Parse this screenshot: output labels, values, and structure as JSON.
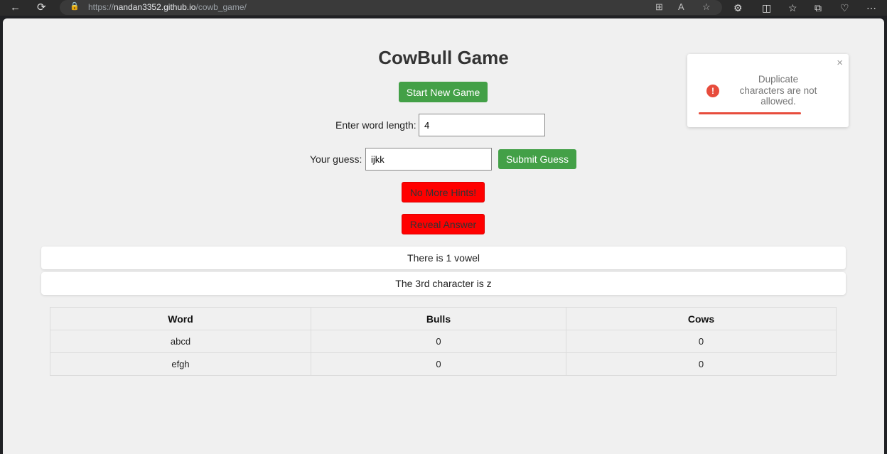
{
  "browser": {
    "url_scheme": "https://",
    "url_host": "nandan3352.github.io",
    "url_path": "/cowb_game/",
    "icons": {
      "back": "←",
      "refresh": "⟳",
      "lock": "🔒",
      "grid": "⊞",
      "read_aloud": "A",
      "favorite": "☆",
      "extensions": "⚙",
      "split": "◫",
      "favorites": "☆",
      "collections": "⧉",
      "health": "♡",
      "more": "⋯"
    }
  },
  "game": {
    "title": "CowBull Game",
    "start_button": "Start New Game",
    "length_label": "Enter word length:",
    "length_value": "4",
    "guess_label": "Your guess:",
    "guess_value": "ijkk",
    "submit_button": "Submit Guess",
    "hints_button": "No More Hints!",
    "reveal_button": "Reveal Answer",
    "hints": [
      "There is 1 vowel",
      "The 3rd character is z"
    ],
    "table": {
      "headers": [
        "Word",
        "Bulls",
        "Cows"
      ],
      "rows": [
        [
          "abcd",
          "0",
          "0"
        ],
        [
          "efgh",
          "0",
          "0"
        ]
      ]
    }
  },
  "toast": {
    "message": "Duplicate characters are not allowed.",
    "icon": "!",
    "close": "×",
    "progress_fraction": 0.64
  },
  "colors": {
    "green": "#43a047",
    "red": "#ff0000",
    "toast_red": "#e74c3c"
  }
}
